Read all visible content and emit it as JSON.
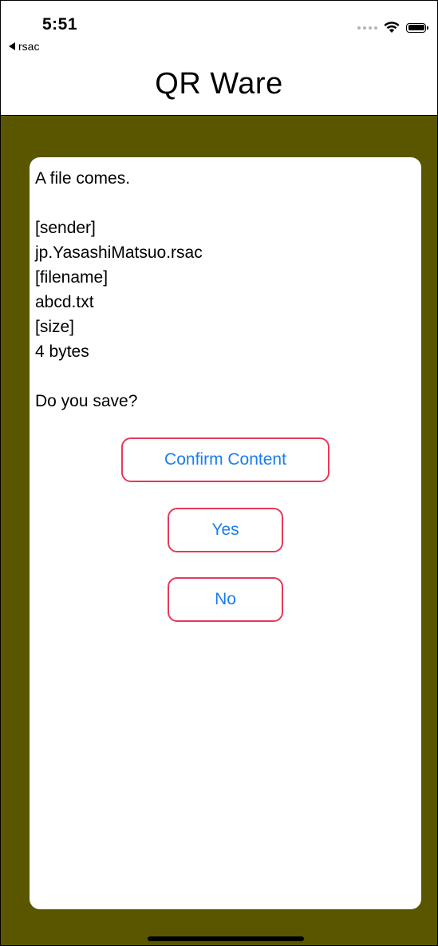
{
  "status_bar": {
    "time": "5:51",
    "back_app": "rsac",
    "icons": [
      "signal-icon",
      "wifi-icon",
      "battery-icon"
    ]
  },
  "nav": {
    "title": "QR Ware"
  },
  "dialog": {
    "message": "A file comes.\n\n[sender]\njp.YasashiMatsuo.rsac\n[filename]\nabcd.txt\n[size]\n4 bytes\n\nDo you save?",
    "buttons": {
      "confirm": "Confirm Content",
      "yes": "Yes",
      "no": "No"
    }
  },
  "colors": {
    "background": "#5a5600",
    "button_border": "#e8385a",
    "button_text": "#1a7cf0"
  }
}
